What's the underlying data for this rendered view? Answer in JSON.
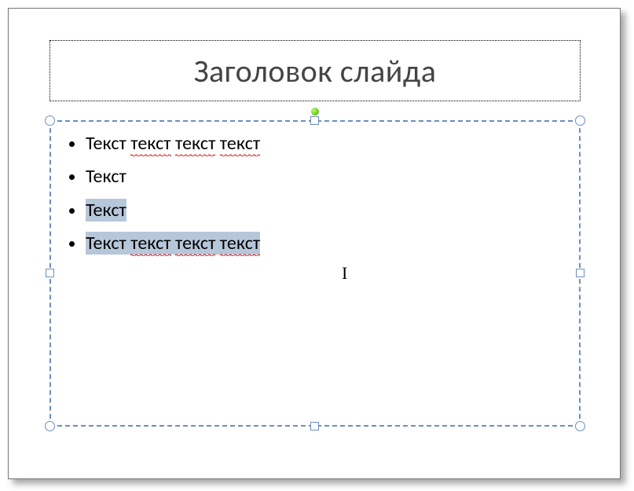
{
  "title": {
    "text": "Заголовок слайда"
  },
  "content": {
    "items": [
      {
        "leading": "Текст ",
        "squiggle_words": [
          "текст",
          "текст",
          "текст"
        ],
        "selected": false
      },
      {
        "leading": "Текст",
        "squiggle_words": [],
        "selected": false
      },
      {
        "leading": "Текст",
        "squiggle_words": [],
        "selected": true
      },
      {
        "leading": "Текст ",
        "squiggle_words": [
          "текст",
          "текст",
          "текст"
        ],
        "selected": true
      }
    ]
  },
  "cursor_glyph": "I"
}
